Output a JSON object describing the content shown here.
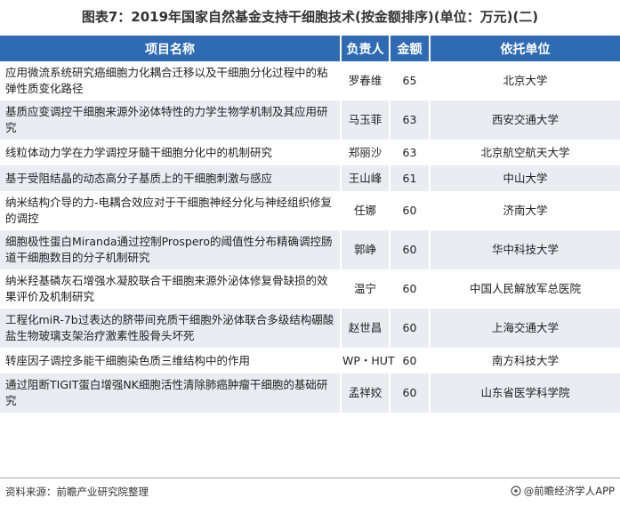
{
  "title": "图表7：2019年国家自然基金支持干细胞技术(按金额排序)(单位：万元)(二)",
  "table": {
    "headers": [
      "项目名称",
      "负责人",
      "金额",
      "依托单位"
    ],
    "rows": [
      {
        "name": "应用微流系统研究癌细胞力化耦合迁移以及干细胞分化过程中的粘弹性质变化路径",
        "leader": "罗春维",
        "amount": "65",
        "unit": "北京大学"
      },
      {
        "name": "基质应变调控干细胞来源外泌体特性的力学生物学机制及其应用研究",
        "leader": "马玉菲",
        "amount": "63",
        "unit": "西安交通大学"
      },
      {
        "name": "线粒体动力学在力学调控牙髓干细胞分化中的机制研究",
        "leader": "郑丽沙",
        "amount": "63",
        "unit": "北京航空航天大学"
      },
      {
        "name": "基于受阻结晶的动态高分子基质上的干细胞刺激与感应",
        "leader": "王山峰",
        "amount": "61",
        "unit": "中山大学"
      },
      {
        "name": "纳米结构介导的力-电耦合效应对于干细胞神经分化与神经组织修复的调控",
        "leader": "任娜",
        "amount": "60",
        "unit": "济南大学"
      },
      {
        "name": "细胞极性蛋白Miranda通过控制Prospero的阈值性分布精确调控肠道干细胞数目的分子机制研究",
        "leader": "郭峥",
        "amount": "60",
        "unit": "华中科技大学"
      },
      {
        "name": "纳米羟基磷灰石增强水凝胶联合干细胞来源外泌体修复骨缺损的效果评价及机制研究",
        "leader": "温宁",
        "amount": "60",
        "unit": "中国人民解放军总医院"
      },
      {
        "name": "工程化miR-7b过表达的脐带间充质干细胞外泌体联合多级结构硼酸盐生物玻璃支架治疗激素性股骨头坏死",
        "leader": "赵世昌",
        "amount": "60",
        "unit": "上海交通大学"
      },
      {
        "name": "转座因子调控多能干细胞染色质三维结构中的作用",
        "leader": "WP・HUT",
        "amount": "60",
        "unit": "南方科技大学"
      },
      {
        "name": "通过阻断TIGIT蛋白增强NK细胞活性清除肺癌肿瘤干细胞的基础研究",
        "leader": "孟祥姣",
        "amount": "60",
        "unit": "山东省医学科学院"
      }
    ]
  },
  "footer": {
    "source": "资料来源：前瞻产业研究院整理",
    "brand": "@前瞻经济学人APP"
  },
  "icons": {
    "brand": "brand-logo-icon"
  },
  "colors": {
    "header_bg": "#2f6bb3",
    "row_alt_bg": "#e9edf2"
  }
}
